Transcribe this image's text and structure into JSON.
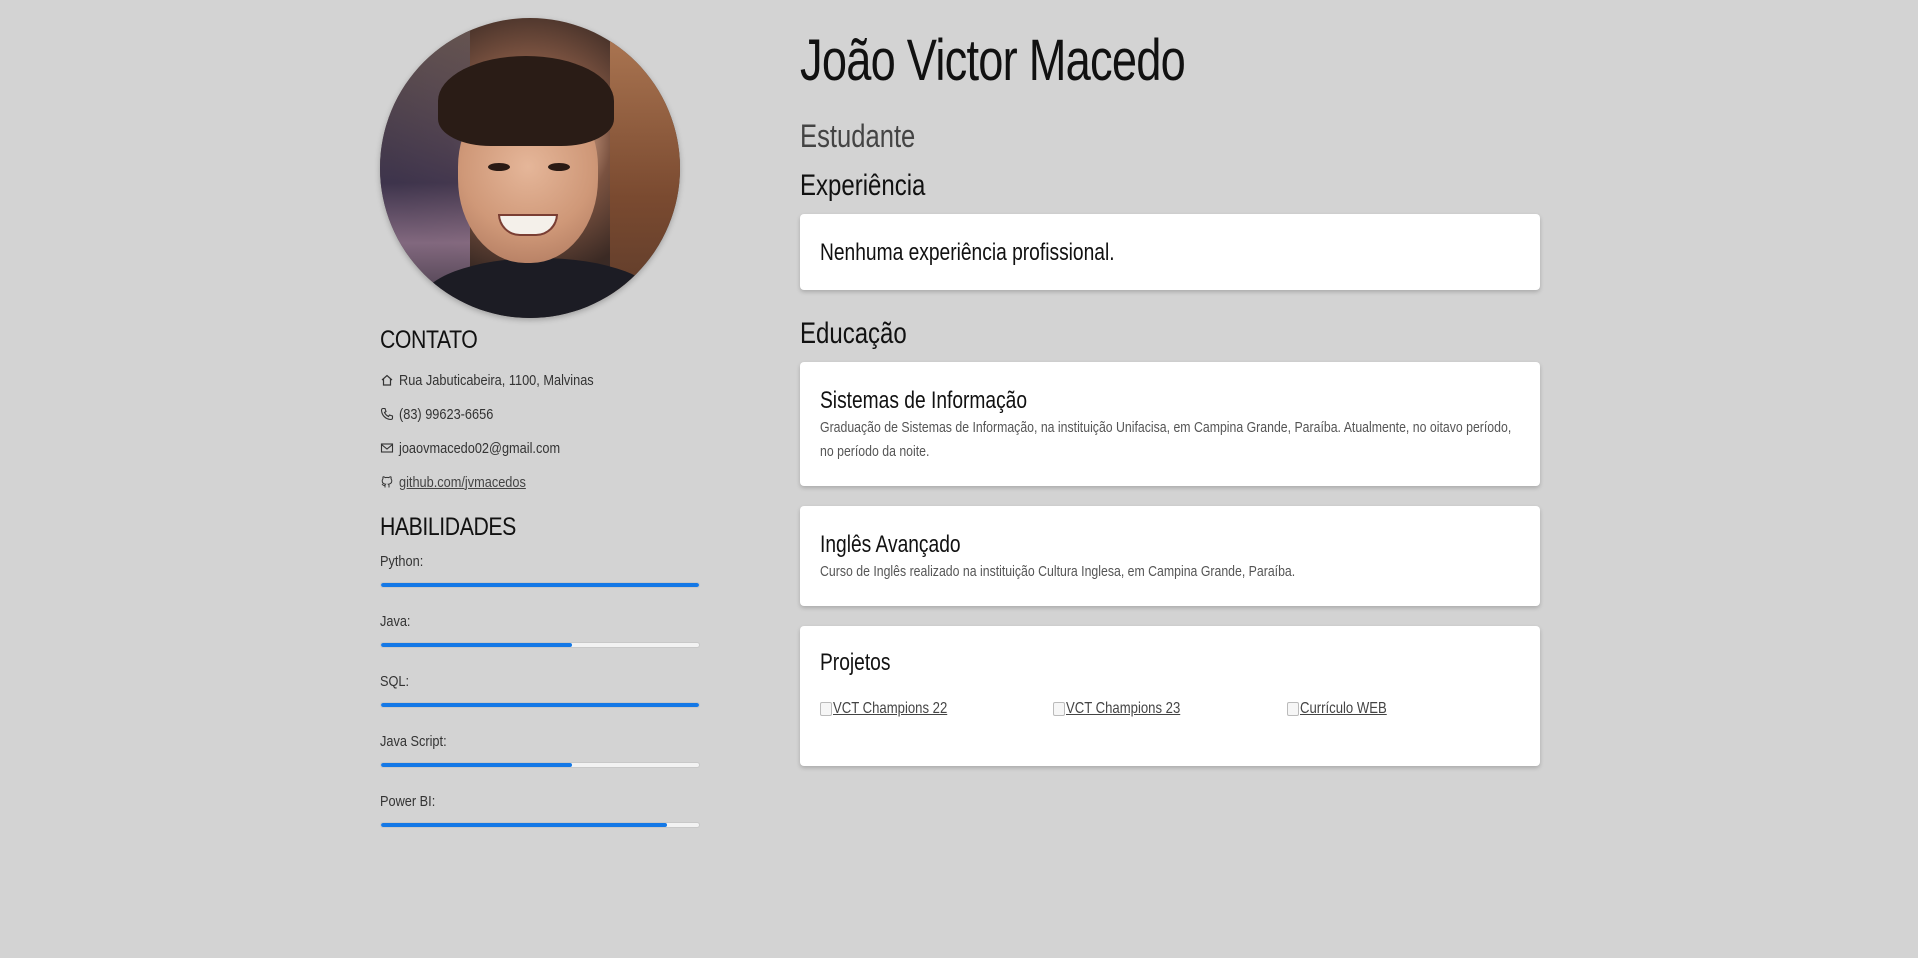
{
  "profile": {
    "name": "João Victor Macedo",
    "role": "Estudante",
    "photo_alt": "João Victor Macedo"
  },
  "contact": {
    "title": "CONTATO",
    "address": "Rua Jabuticabeira, 1100, Malvinas",
    "phone": "(83) 99623-6656",
    "email": "joaovmacedo02@gmail.com",
    "github": "github.com/jvmacedos"
  },
  "skills": {
    "title": "HABILIDADES",
    "accent": "#1478e6",
    "items": [
      {
        "label": "Python:",
        "level": 100
      },
      {
        "label": "Java:",
        "level": 60
      },
      {
        "label": "SQL:",
        "level": 100
      },
      {
        "label": "Java Script:",
        "level": 60
      },
      {
        "label": "Power BI:",
        "level": 90
      }
    ]
  },
  "experience": {
    "title": "Experiência",
    "text": "Nenhuma experiência profissional."
  },
  "education": {
    "title": "Educação",
    "items": [
      {
        "title": "Sistemas de Informação",
        "description": "Graduação de Sistemas de Informação, na instituição Unifacisa, em Campina Grande, Paraíba. Atualmente, no oitavo período, no período da noite."
      },
      {
        "title": "Inglês Avançado",
        "description": "Curso de Inglês realizado na instituição Cultura Inglesa, em Campina Grande, Paraíba."
      }
    ]
  },
  "projects": {
    "title": "Projetos",
    "items": [
      {
        "label": "VCT Champions 22"
      },
      {
        "label": "VCT Champions 23"
      },
      {
        "label": "Currículo WEB"
      }
    ]
  },
  "icons": {
    "address": "home-icon",
    "phone": "phone-icon",
    "email": "mail-icon",
    "github": "github-icon"
  }
}
